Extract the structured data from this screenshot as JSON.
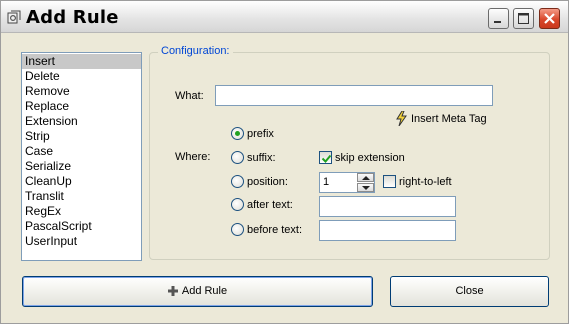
{
  "window": {
    "title": "Add Rule",
    "title_icon": "rule-icon"
  },
  "rule_types": [
    "Insert",
    "Delete",
    "Remove",
    "Replace",
    "Extension",
    "Strip",
    "Case",
    "Serialize",
    "CleanUp",
    "Translit",
    "RegEx",
    "PascalScript",
    "UserInput"
  ],
  "selected_rule": "Insert",
  "config": {
    "legend": "Configuration:",
    "what_label": "What:",
    "what_value": "",
    "meta_tag_label": "Insert Meta Tag",
    "meta_tag_icon": "lightning-icon",
    "where_label": "Where:",
    "options": {
      "prefix": "prefix",
      "suffix": "suffix:",
      "position": "position:",
      "after_text": "after text:",
      "before_text": "before text:"
    },
    "selected_option": "prefix",
    "skip_extension_label": "skip extension",
    "skip_extension_checked": true,
    "position_value": "1",
    "right_to_left_label": "right-to-left",
    "right_to_left_checked": false,
    "after_text_value": "",
    "before_text_value": ""
  },
  "buttons": {
    "add_rule": "Add Rule",
    "add_rule_icon": "plus-icon",
    "close": "Close"
  },
  "colors": {
    "legend": "#0046d5",
    "radio_dot": "#21a121",
    "checkmark": "#21a121"
  }
}
